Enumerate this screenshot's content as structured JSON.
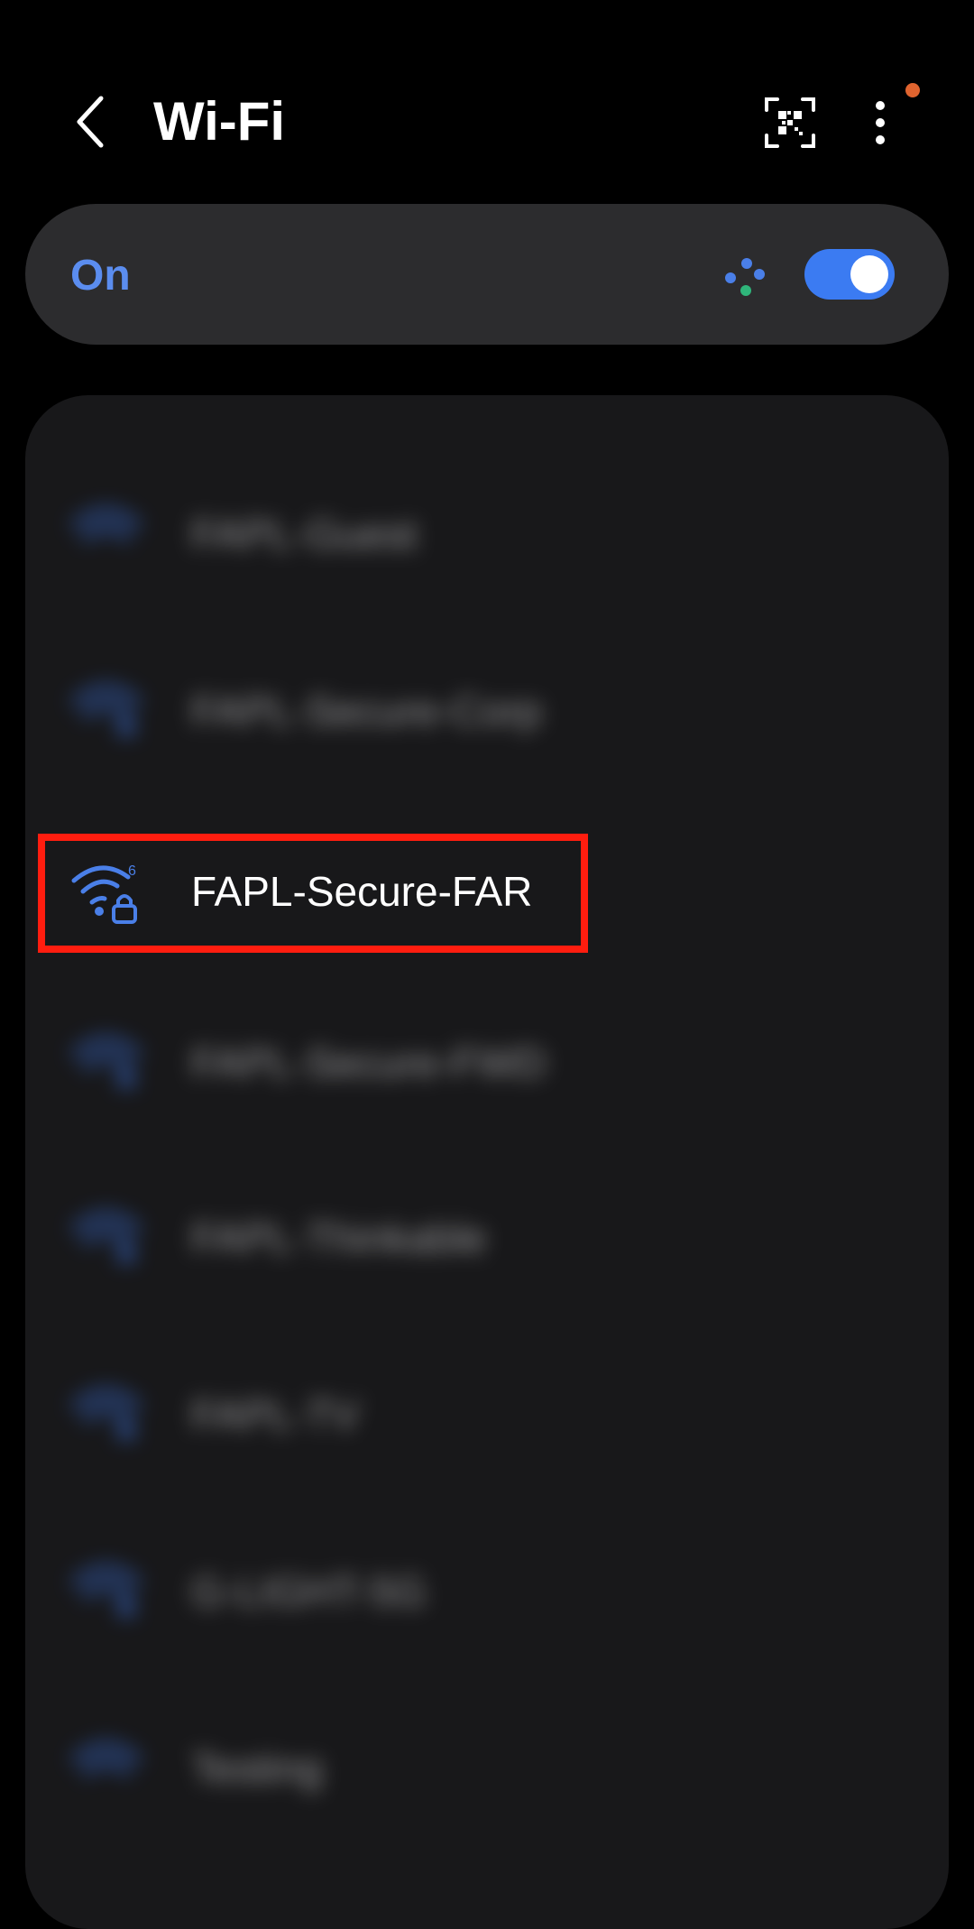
{
  "header": {
    "title": "Wi-Fi",
    "back_icon": "chevron-left-icon",
    "qr_icon": "qr-code-scan-icon",
    "more_icon": "more-vertical-icon",
    "notification_color": "#e0642f"
  },
  "toggle": {
    "label": "On",
    "state": true,
    "accent": "#3b7bf2"
  },
  "networks": [
    {
      "name": "FAPL-Guest",
      "blurred": true
    },
    {
      "name": "FAPL-Secure-Corp",
      "blurred": true
    },
    {
      "name": "FAPL-Secure-FAR",
      "blurred": false,
      "highlighted": true,
      "wifi_standard": "6",
      "secured": true
    },
    {
      "name": "FAPL-Secure-FWD",
      "blurred": true
    },
    {
      "name": "FAPL-Thinkable",
      "blurred": true
    },
    {
      "name": "FAPL-TV",
      "blurred": true
    },
    {
      "name": "G-LIGHT-5G",
      "blurred": true
    },
    {
      "name": "Testing",
      "blurred": true
    }
  ],
  "colors": {
    "background": "#000000",
    "card": "#2c2c2e",
    "list_card": "#18181a",
    "icon_blue": "#4a7fe8",
    "highlight": "#ff1d0f"
  }
}
